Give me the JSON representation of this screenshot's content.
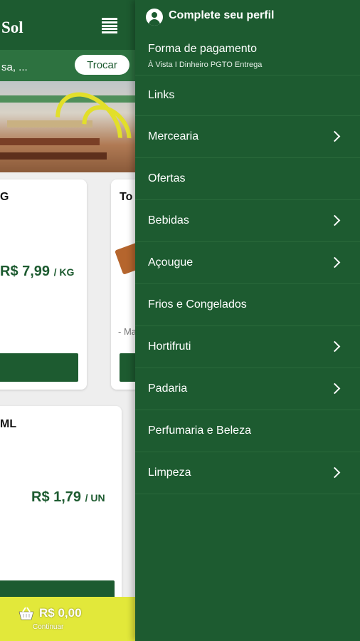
{
  "app": {
    "logo_text": "Sol",
    "address_text": "sa, ...",
    "change_button": "Trocar",
    "products": [
      {
        "title": "G",
        "price": "R$ 7,99",
        "unit": "/ KG"
      },
      {
        "title": "To",
        "subtitle": "- Ma"
      },
      {
        "title": "ML",
        "price": "R$ 1,79",
        "unit": "/ UN"
      }
    ],
    "cart": {
      "total": "R$ 0,00",
      "label": "Continuar"
    }
  },
  "drawer": {
    "profile_label": "Complete seu perfil",
    "payment": {
      "title": "Forma de pagamento",
      "subtitle": "À Vista I Dinheiro PGTO Entrega"
    },
    "menu": [
      {
        "label": "Links",
        "has_submenu": false
      },
      {
        "label": "Mercearia",
        "has_submenu": true
      },
      {
        "label": "Ofertas",
        "has_submenu": false
      },
      {
        "label": "Bebidas",
        "has_submenu": true
      },
      {
        "label": "Açougue",
        "has_submenu": true
      },
      {
        "label": "Frios e Congelados",
        "has_submenu": false
      },
      {
        "label": "Hortifruti",
        "has_submenu": true
      },
      {
        "label": "Padaria",
        "has_submenu": true
      },
      {
        "label": "Perfumaria e Beleza",
        "has_submenu": false
      },
      {
        "label": "Limpeza",
        "has_submenu": true
      }
    ]
  },
  "colors": {
    "primary": "#1d5b30",
    "accent": "#e2e83a",
    "price": "#1d5b30"
  }
}
